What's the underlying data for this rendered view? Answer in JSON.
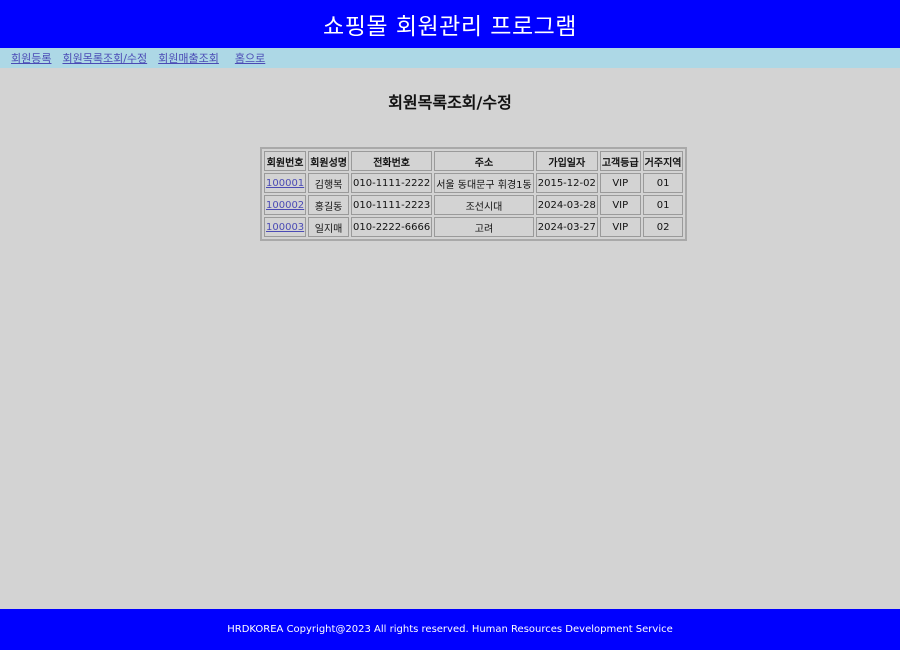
{
  "header": {
    "title": "쇼핑몰 회원관리 프로그램"
  },
  "nav": {
    "items": [
      "회원등록",
      "회원목록조회/수정",
      "회원매출조회",
      "홈으로"
    ]
  },
  "main": {
    "title": "회원목록조회/수정",
    "table": {
      "columns": [
        "회원번호",
        "회원성명",
        "전화번호",
        "주소",
        "가입일자",
        "고객등급",
        "거주지역"
      ],
      "rows": [
        [
          "100001",
          "김행복",
          "010-1111-2222",
          "서울 동대문구 휘경1동",
          "2015-12-02",
          "VIP",
          "01"
        ],
        [
          "100002",
          "홍길동",
          "010-1111-2223",
          "조선시대",
          "2024-03-28",
          "VIP",
          "01"
        ],
        [
          "100003",
          "일지매",
          "010-2222-6666",
          "고려",
          "2024-03-27",
          "VIP",
          "02"
        ]
      ]
    }
  },
  "footer": {
    "text": "HRDKOREA Copyright@2023 All rights reserved. Human Resources Development Service"
  },
  "colors": {
    "header_bg": "#0000ff",
    "nav_bg": "#add8e6",
    "page_bg": "#d3d3d3",
    "link": "#4b4bb5"
  }
}
